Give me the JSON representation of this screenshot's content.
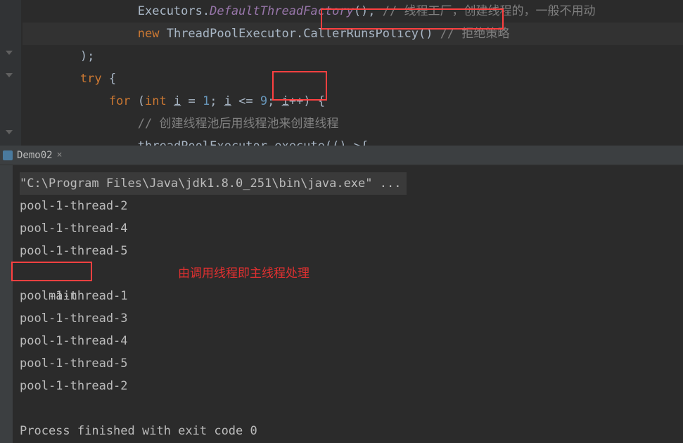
{
  "editor": {
    "line0_pre": "                Executors.",
    "line0_method": "DefaultThreadFactory",
    "line0_paren": "()",
    "line0_comma": ", ",
    "line0_comment": "// 线程工厂，创建线程的，一般不用动",
    "line1_indent": "                ",
    "line1_new": "new ",
    "line1_type": "ThreadPoolExecutor",
    "line1_dot": ".",
    "line1_policy": "CallerRunsPolicy()",
    "line1_space": " ",
    "line1_comment": "// 拒绝策略",
    "line2": "        );",
    "line3_indent": "        ",
    "line3_try": "try ",
    "line3_brace": "{",
    "line4_indent": "            ",
    "line4_for": "for ",
    "line4_paren1": "(",
    "line4_int": "int ",
    "line4_i1": "i",
    "line4_eq": " = ",
    "line4_one": "1",
    "line4_semi1": "; ",
    "line4_i2": "i",
    "line4_lte": " <= ",
    "line4_nine": "9",
    "line4_semi2": "; ",
    "line4_i3": "i",
    "line4_pp": "++) {",
    "line5_indent": "                ",
    "line5_comment": "// 创建线程池后用线程池来创建线程",
    "line6_indent": "                ",
    "line6_call": "threadPoolExecutor.execute(()->{"
  },
  "tab": {
    "label": "Demo02",
    "close": "×"
  },
  "console": {
    "cmd": "\"C:\\Program Files\\Java\\jdk1.8.0_251\\bin\\java.exe\" ...",
    "lines": [
      "pool-1-thread-2",
      "pool-1-thread-4",
      "pool-1-thread-5",
      "main",
      "pool-1-thread-1",
      "pool-1-thread-3",
      "pool-1-thread-4",
      "pool-1-thread-5",
      "pool-1-thread-2"
    ],
    "exit": "Process finished with exit code 0"
  },
  "annotation": {
    "text": "由调用线程即主线程处理"
  }
}
